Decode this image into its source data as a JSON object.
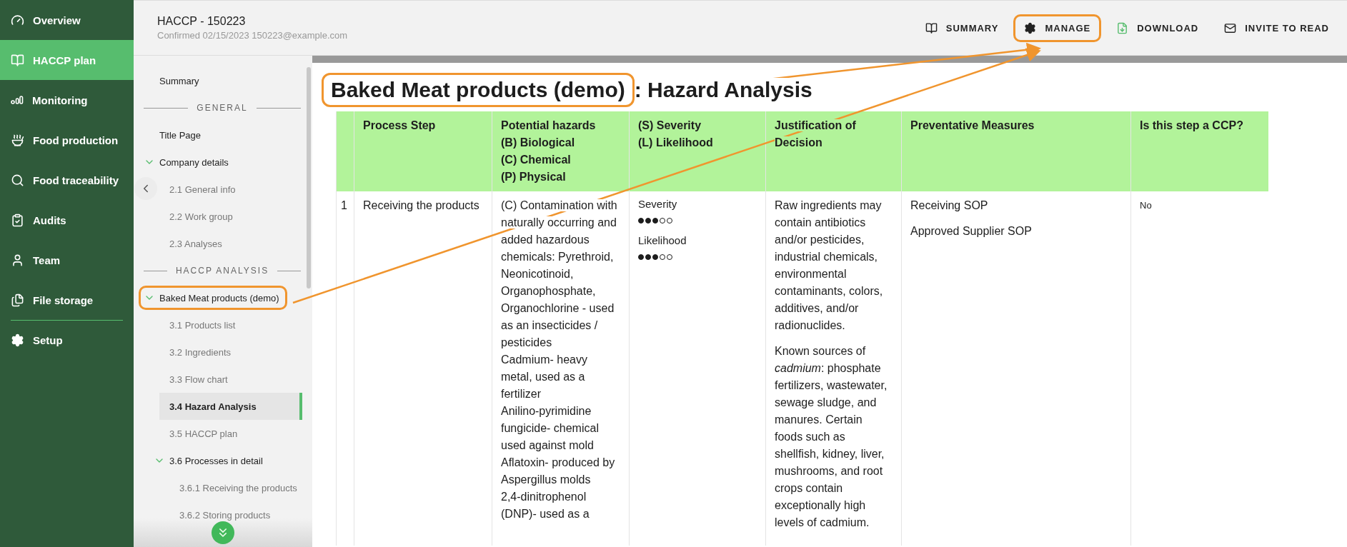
{
  "nav": {
    "items": [
      {
        "label": "Overview",
        "selected": false,
        "separated": false
      },
      {
        "label": "HACCP plan",
        "selected": true,
        "separated": false
      },
      {
        "label": "Monitoring",
        "selected": false,
        "separated": false
      },
      {
        "label": "Food production",
        "selected": false,
        "separated": false
      },
      {
        "label": "Food traceability",
        "selected": false,
        "separated": false
      },
      {
        "label": "Audits",
        "selected": false,
        "separated": false
      },
      {
        "label": "Team",
        "selected": false,
        "separated": false
      },
      {
        "label": "File storage",
        "selected": false,
        "separated": false
      },
      {
        "label": "Setup",
        "selected": false,
        "separated": true
      }
    ]
  },
  "header": {
    "title": "HACCP - 150223",
    "subtitle": "Confirmed 02/15/2023 150223@example.com",
    "actions": [
      {
        "label": "SUMMARY",
        "highlighted": false
      },
      {
        "label": "MANAGE",
        "highlighted": true
      },
      {
        "label": "DOWNLOAD",
        "highlighted": false
      },
      {
        "label": "INVITE TO READ",
        "highlighted": false
      }
    ]
  },
  "outline": {
    "items": [
      {
        "kind": "link",
        "label": "Summary",
        "selected": false
      },
      {
        "kind": "heading",
        "label": "GENERAL"
      },
      {
        "kind": "link",
        "label": "Title Page",
        "selected": false
      },
      {
        "kind": "group",
        "label": "Company details",
        "expanded": true,
        "highlighted": false,
        "children": [
          {
            "kind": "link",
            "label": "2.1 General info",
            "selected": false
          },
          {
            "kind": "link",
            "label": "2.2 Work group",
            "selected": false
          },
          {
            "kind": "link",
            "label": "2.3 Analyses",
            "selected": false
          }
        ]
      },
      {
        "kind": "heading",
        "label": "HACCP ANALYSIS"
      },
      {
        "kind": "group",
        "label": "Baked Meat products (demo)",
        "expanded": true,
        "highlighted": true,
        "children": [
          {
            "kind": "link",
            "label": "3.1 Products list",
            "selected": false
          },
          {
            "kind": "link",
            "label": "3.2 Ingredients",
            "selected": false
          },
          {
            "kind": "link",
            "label": "3.3 Flow chart",
            "selected": false
          },
          {
            "kind": "link",
            "label": "3.4 Hazard Analysis",
            "selected": true
          },
          {
            "kind": "link",
            "label": "3.5 HACCP plan",
            "selected": false
          },
          {
            "kind": "group",
            "label": "3.6 Processes in detail",
            "expanded": true,
            "highlighted": false,
            "children": [
              {
                "kind": "link",
                "label": "3.6.1 Receiving the products",
                "selected": false
              },
              {
                "kind": "link",
                "label": "3.6.2 Storing products",
                "selected": false
              }
            ]
          }
        ]
      }
    ]
  },
  "page": {
    "title_product": "Baked Meat products (demo)",
    "title_suffix": ": Hazard Analysis",
    "title_highlighted": true
  },
  "table": {
    "columns": [
      {
        "lines": [
          "Process Step"
        ]
      },
      {
        "lines": [
          "Potential hazards",
          "(B) Biological",
          "(C) Chemical",
          "(P) Physical"
        ]
      },
      {
        "lines": [
          "(S) Severity",
          "(L) Likelihood"
        ]
      },
      {
        "lines": [
          "Justification of",
          "Decision"
        ]
      },
      {
        "lines": [
          "Preventative Measures"
        ]
      },
      {
        "lines": [
          "Is this step a CCP?"
        ]
      }
    ],
    "rows": [
      {
        "number": "1",
        "process_step": "Receiving the products",
        "hazards": [
          "(C) Contamination with naturally occurring and added hazardous chemicals: Pyrethroid, Neonicotinoid, Organophosphate, Organochlorine - used as an insecticides / pesticides",
          "Cadmium- heavy metal, used as a fertilizer",
          "Anilino-pyrimidine fungicide- chemical used against mold",
          "Aflatoxin- produced by Aspergillus molds",
          "2,4-dinitrophenol (DNP)- used as a"
        ],
        "ratings": [
          {
            "label": "Severity",
            "stars": 3
          },
          {
            "label": "Likelihood",
            "stars": 3
          }
        ],
        "justification": [
          "Raw ingredients may contain antibiotics and/or pesticides, industrial chemicals, environmental contaminants, colors, additives, and/or radionuclides.",
          "Known sources of *cadmium*: phosphate fertilizers, wastewater, sewage sludge, and manures. Certain foods such as shellfish, kidney, liver, mushrooms, and root crops contain exceptionally high levels of cadmium."
        ],
        "measures": [
          "Receiving SOP",
          "Approved Supplier SOP"
        ],
        "ccp": "No"
      }
    ]
  }
}
